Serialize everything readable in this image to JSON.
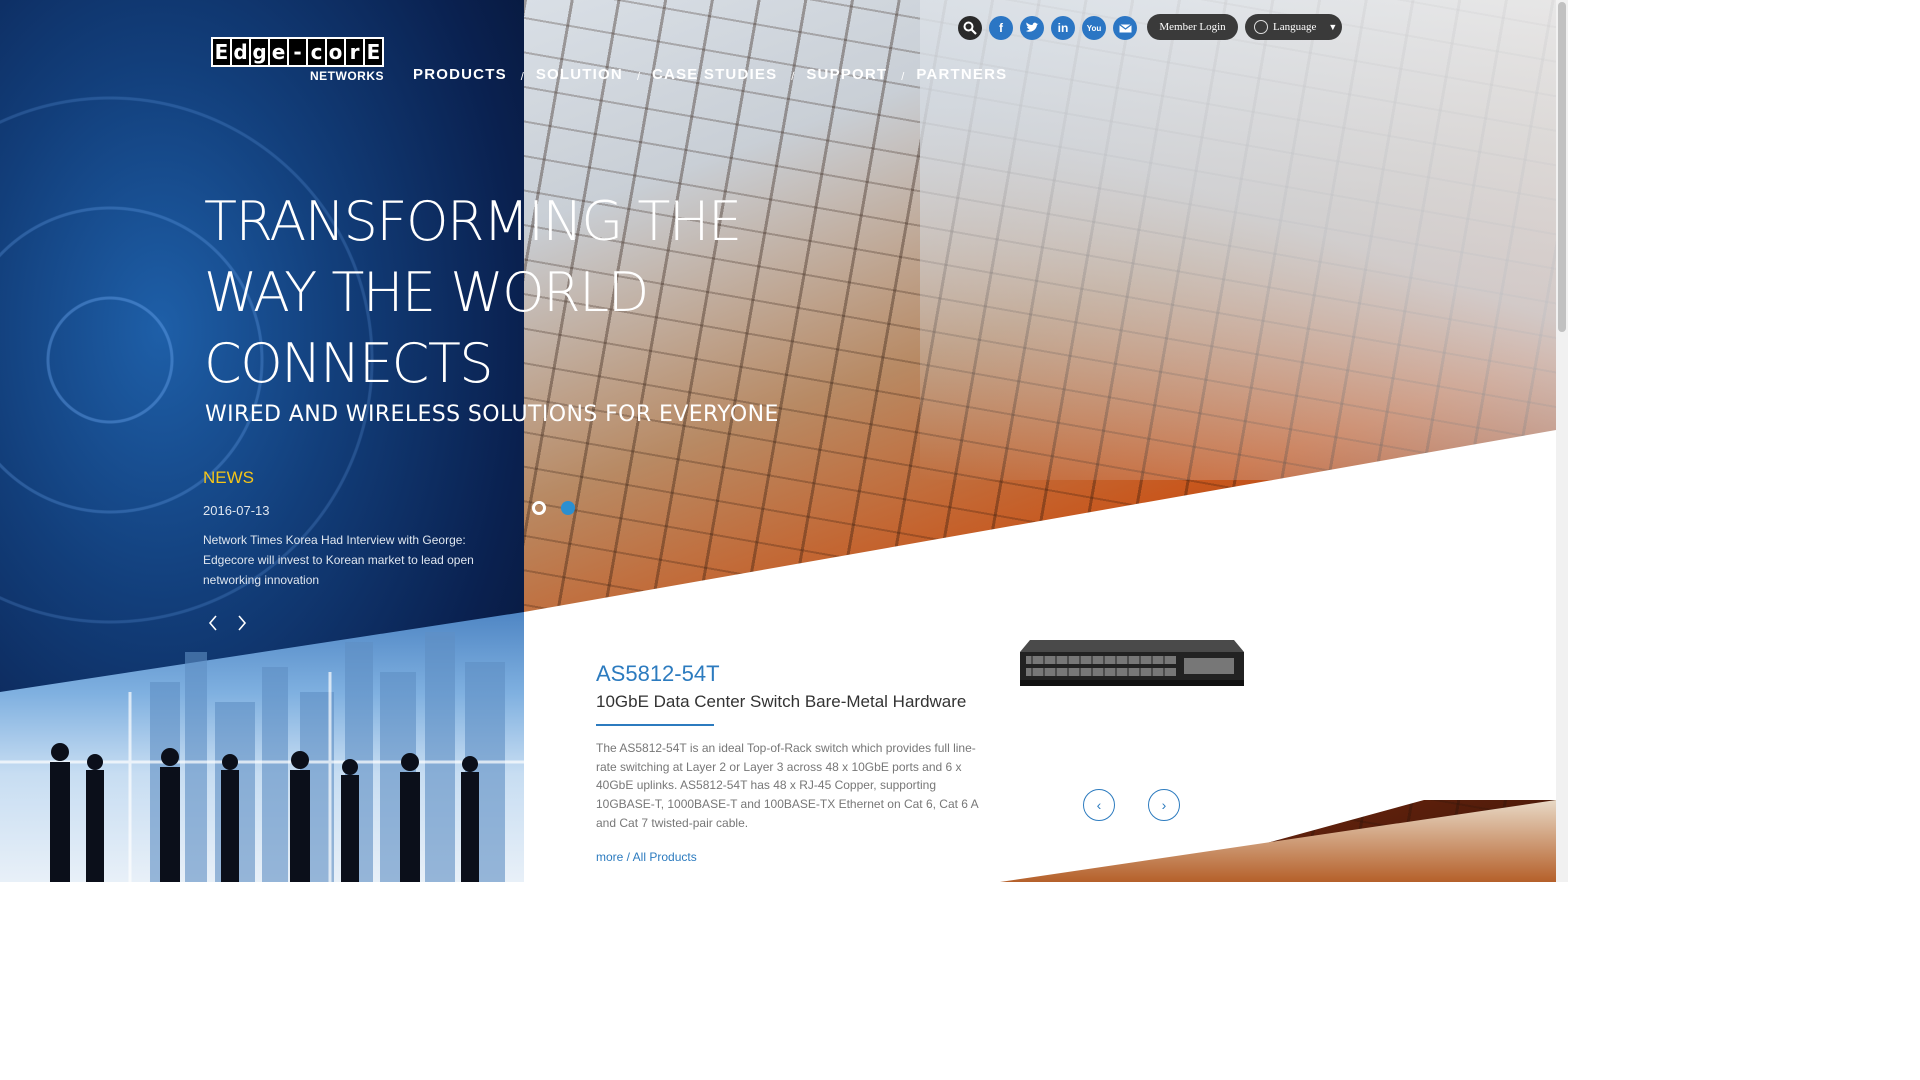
{
  "header": {
    "logo_letters": [
      "E",
      "d",
      "g",
      "e",
      "-",
      "c",
      "o",
      "r",
      "E"
    ],
    "logo_sub": "NETWORKS",
    "nav": [
      {
        "label": "PRODUCTS"
      },
      {
        "label": "SOLUTION"
      },
      {
        "label": "CASE STUDIES"
      },
      {
        "label": "SUPPORT"
      },
      {
        "label": "PARTNERS"
      }
    ],
    "nav_separator": "/",
    "social_icons": [
      "search-icon",
      "facebook-icon",
      "twitter-icon",
      "linkedin-icon",
      "youtube-icon",
      "mail-icon"
    ],
    "member_login": "Member Login",
    "language": "Language"
  },
  "hero": {
    "title_lines": [
      "TRANSFORMING THE",
      "WAY THE WORLD",
      "CONNECTS"
    ],
    "subtitle": "WIRED AND WIRELESS SOLUTIONS FOR EVERYONE"
  },
  "news": {
    "heading": "NEWS",
    "date": "2016-07-13",
    "text": "Network Times Korea Had Interview with George: Edgecore will invest to Korean market to lead open networking innovation"
  },
  "product": {
    "name": "AS5812-54T",
    "subtitle": "10GbE Data Center Switch Bare-Metal Hardware",
    "description": "The AS5812-54T is an ideal Top-of-Rack switch which provides full line-rate switching at Layer 2 or Layer 3 across 48 x 10GbE ports and 6 x 40GbE uplinks. AS5812-54T has 48 x RJ-45 Copper, supporting 10GBASE-T, 1000BASE-T and 100BASE-TX Ethernet on Cat 6, Cat 6 A and Cat 7 twisted-pair cable.",
    "more_link": "more / All Products"
  },
  "colors": {
    "accent_blue": "#2c7bbf",
    "news_yellow": "#f5c518"
  }
}
